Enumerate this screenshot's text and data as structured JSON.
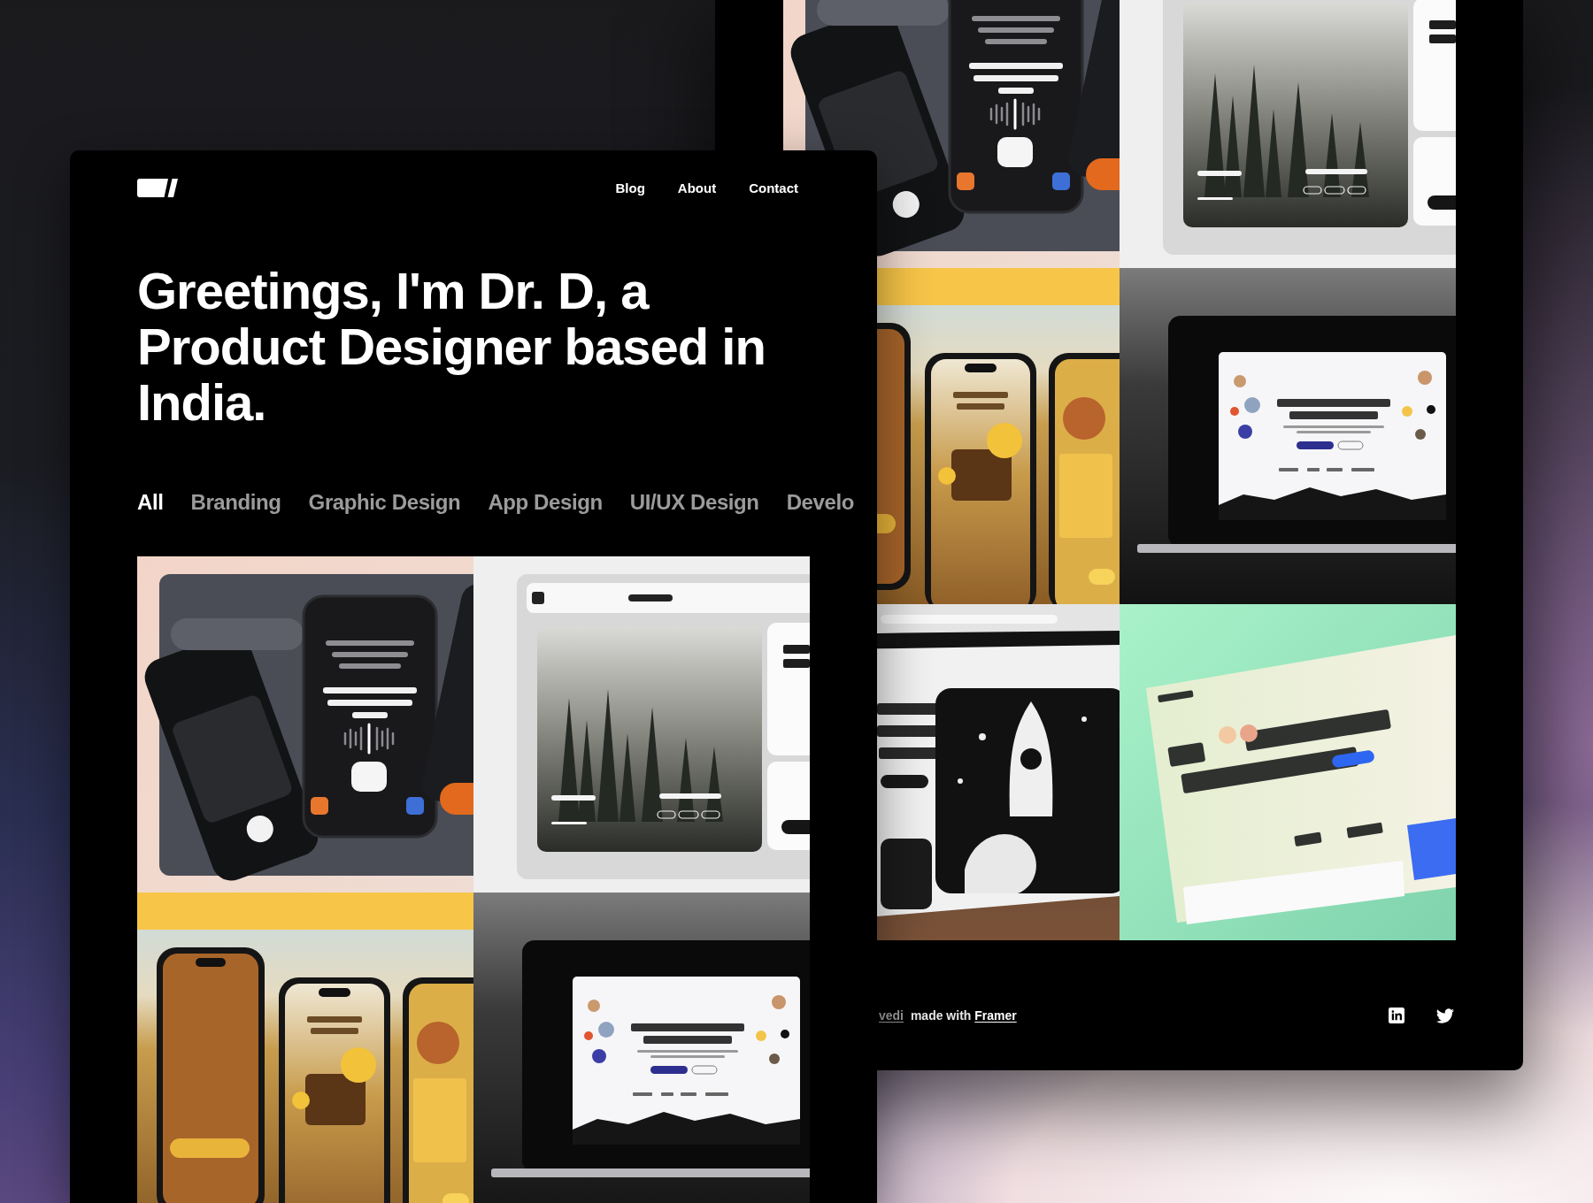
{
  "left_panel": {
    "nav": [
      "Blog",
      "About",
      "Contact"
    ],
    "heading": "Greetings, I'm Dr. D, a Product Designer based in India.",
    "filters": [
      {
        "label": "All",
        "selected": true
      },
      {
        "label": "Branding",
        "selected": false
      },
      {
        "label": "Graphic Design",
        "selected": false
      },
      {
        "label": "App Design",
        "selected": false
      },
      {
        "label": "UI/UX Design",
        "selected": false
      },
      {
        "label": "Develo",
        "selected": false
      }
    ],
    "projects": [
      {
        "kind": "coach"
      },
      {
        "kind": "travel"
      },
      {
        "kind": "camera"
      },
      {
        "kind": "affiliate"
      }
    ]
  },
  "right_panel": {
    "projects": [
      {
        "kind": "coach"
      },
      {
        "kind": "travel"
      },
      {
        "kind": "camera"
      },
      {
        "kind": "affiliate"
      },
      {
        "kind": "teamwork"
      },
      {
        "kind": "mindfulness"
      }
    ],
    "footer": {
      "author_link": "vedi",
      "text": "made with",
      "framer_link": "Framer"
    }
  }
}
